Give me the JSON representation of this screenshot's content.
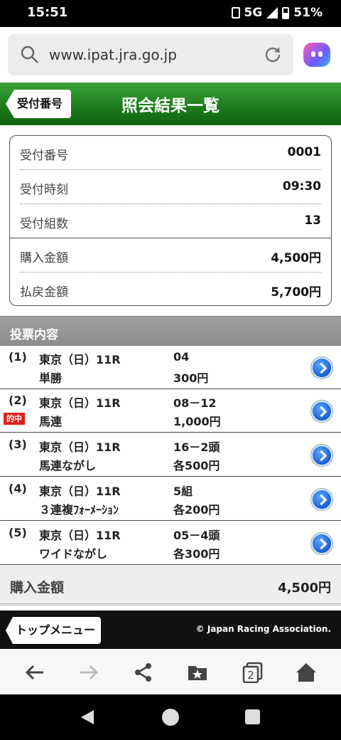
{
  "status": {
    "time": "15:51",
    "network": "5G",
    "battery": "51%"
  },
  "browser": {
    "url": "www.ipat.jra.go.jp"
  },
  "header": {
    "back_label": "受付番号",
    "title": "照会結果一覧"
  },
  "summary": {
    "rows": [
      {
        "label": "受付番号",
        "value": "0001"
      },
      {
        "label": "受付時刻",
        "value": "09:30"
      },
      {
        "label": "受付組数",
        "value": "13"
      },
      {
        "label": "購入金額",
        "value": "4,500円"
      },
      {
        "label": "払戻金額",
        "value": "5,700円"
      }
    ]
  },
  "bets_header": "投票内容",
  "bets": [
    {
      "index": "(1)",
      "race": "東京（日）11R",
      "type": "単勝",
      "combo": "04",
      "amount": "300円",
      "hit": ""
    },
    {
      "index": "(2)",
      "race": "東京（日）11R",
      "type": "馬連",
      "combo": "08－12",
      "amount": "1,000円",
      "hit": "的中"
    },
    {
      "index": "(3)",
      "race": "東京（日）11R",
      "type": "馬連ながし",
      "combo": "16－2頭",
      "amount": "各500円",
      "hit": ""
    },
    {
      "index": "(4)",
      "race": "東京（日）11R",
      "type": "３連複ﾌｫｰﾒｰｼｮﾝ",
      "combo": "5組",
      "amount": "各200円",
      "hit": ""
    },
    {
      "index": "(5)",
      "race": "東京（日）11R",
      "type": "ワイドながし",
      "combo": "05－4頭",
      "amount": "各300円",
      "hit": ""
    }
  ],
  "total": {
    "label": "購入金額",
    "value": "4,500円"
  },
  "footer": {
    "top_menu": "トップメニュー",
    "copyright": "© Japan Racing Association."
  },
  "browser_nav": {
    "tabs_count": "2"
  }
}
